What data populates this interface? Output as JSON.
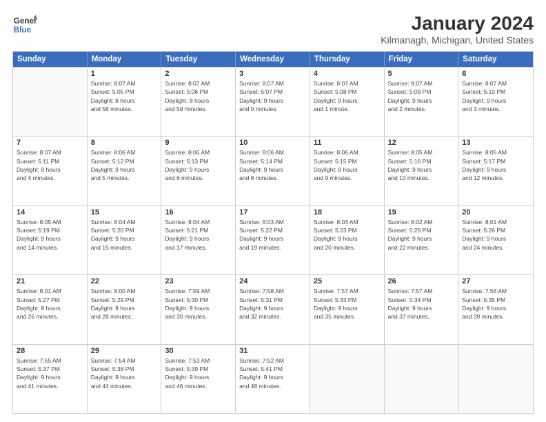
{
  "logo": {
    "line1": "General",
    "line2": "Blue"
  },
  "title": "January 2024",
  "subtitle": "Kilmanagh, Michigan, United States",
  "days_of_week": [
    "Sunday",
    "Monday",
    "Tuesday",
    "Wednesday",
    "Thursday",
    "Friday",
    "Saturday"
  ],
  "weeks": [
    [
      {
        "day": "",
        "info": ""
      },
      {
        "day": "1",
        "info": "Sunrise: 8:07 AM\nSunset: 5:05 PM\nDaylight: 8 hours\nand 58 minutes."
      },
      {
        "day": "2",
        "info": "Sunrise: 8:07 AM\nSunset: 5:06 PM\nDaylight: 8 hours\nand 59 minutes."
      },
      {
        "day": "3",
        "info": "Sunrise: 8:07 AM\nSunset: 5:07 PM\nDaylight: 9 hours\nand 0 minutes."
      },
      {
        "day": "4",
        "info": "Sunrise: 8:07 AM\nSunset: 5:08 PM\nDaylight: 9 hours\nand 1 minute."
      },
      {
        "day": "5",
        "info": "Sunrise: 8:07 AM\nSunset: 5:09 PM\nDaylight: 9 hours\nand 2 minutes."
      },
      {
        "day": "6",
        "info": "Sunrise: 8:07 AM\nSunset: 5:10 PM\nDaylight: 9 hours\nand 3 minutes."
      }
    ],
    [
      {
        "day": "7",
        "info": "Sunrise: 8:07 AM\nSunset: 5:11 PM\nDaylight: 9 hours\nand 4 minutes."
      },
      {
        "day": "8",
        "info": "Sunrise: 8:06 AM\nSunset: 5:12 PM\nDaylight: 9 hours\nand 5 minutes."
      },
      {
        "day": "9",
        "info": "Sunrise: 8:06 AM\nSunset: 5:13 PM\nDaylight: 9 hours\nand 6 minutes."
      },
      {
        "day": "10",
        "info": "Sunrise: 8:06 AM\nSunset: 5:14 PM\nDaylight: 9 hours\nand 8 minutes."
      },
      {
        "day": "11",
        "info": "Sunrise: 8:06 AM\nSunset: 5:15 PM\nDaylight: 9 hours\nand 9 minutes."
      },
      {
        "day": "12",
        "info": "Sunrise: 8:05 AM\nSunset: 5:16 PM\nDaylight: 9 hours\nand 10 minutes."
      },
      {
        "day": "13",
        "info": "Sunrise: 8:05 AM\nSunset: 5:17 PM\nDaylight: 9 hours\nand 12 minutes."
      }
    ],
    [
      {
        "day": "14",
        "info": "Sunrise: 8:05 AM\nSunset: 5:19 PM\nDaylight: 9 hours\nand 14 minutes."
      },
      {
        "day": "15",
        "info": "Sunrise: 8:04 AM\nSunset: 5:20 PM\nDaylight: 9 hours\nand 15 minutes."
      },
      {
        "day": "16",
        "info": "Sunrise: 8:04 AM\nSunset: 5:21 PM\nDaylight: 9 hours\nand 17 minutes."
      },
      {
        "day": "17",
        "info": "Sunrise: 8:03 AM\nSunset: 5:22 PM\nDaylight: 9 hours\nand 19 minutes."
      },
      {
        "day": "18",
        "info": "Sunrise: 8:03 AM\nSunset: 5:23 PM\nDaylight: 9 hours\nand 20 minutes."
      },
      {
        "day": "19",
        "info": "Sunrise: 8:02 AM\nSunset: 5:25 PM\nDaylight: 9 hours\nand 22 minutes."
      },
      {
        "day": "20",
        "info": "Sunrise: 8:01 AM\nSunset: 5:26 PM\nDaylight: 9 hours\nand 24 minutes."
      }
    ],
    [
      {
        "day": "21",
        "info": "Sunrise: 8:01 AM\nSunset: 5:27 PM\nDaylight: 9 hours\nand 26 minutes."
      },
      {
        "day": "22",
        "info": "Sunrise: 8:00 AM\nSunset: 5:29 PM\nDaylight: 9 hours\nand 28 minutes."
      },
      {
        "day": "23",
        "info": "Sunrise: 7:59 AM\nSunset: 5:30 PM\nDaylight: 9 hours\nand 30 minutes."
      },
      {
        "day": "24",
        "info": "Sunrise: 7:58 AM\nSunset: 5:31 PM\nDaylight: 9 hours\nand 32 minutes."
      },
      {
        "day": "25",
        "info": "Sunrise: 7:57 AM\nSunset: 5:33 PM\nDaylight: 9 hours\nand 35 minutes."
      },
      {
        "day": "26",
        "info": "Sunrise: 7:57 AM\nSunset: 5:34 PM\nDaylight: 9 hours\nand 37 minutes."
      },
      {
        "day": "27",
        "info": "Sunrise: 7:56 AM\nSunset: 5:35 PM\nDaylight: 9 hours\nand 39 minutes."
      }
    ],
    [
      {
        "day": "28",
        "info": "Sunrise: 7:55 AM\nSunset: 5:37 PM\nDaylight: 9 hours\nand 41 minutes."
      },
      {
        "day": "29",
        "info": "Sunrise: 7:54 AM\nSunset: 5:38 PM\nDaylight: 9 hours\nand 44 minutes."
      },
      {
        "day": "30",
        "info": "Sunrise: 7:53 AM\nSunset: 5:39 PM\nDaylight: 9 hours\nand 46 minutes."
      },
      {
        "day": "31",
        "info": "Sunrise: 7:52 AM\nSunset: 5:41 PM\nDaylight: 9 hours\nand 48 minutes."
      },
      {
        "day": "",
        "info": ""
      },
      {
        "day": "",
        "info": ""
      },
      {
        "day": "",
        "info": ""
      }
    ]
  ]
}
